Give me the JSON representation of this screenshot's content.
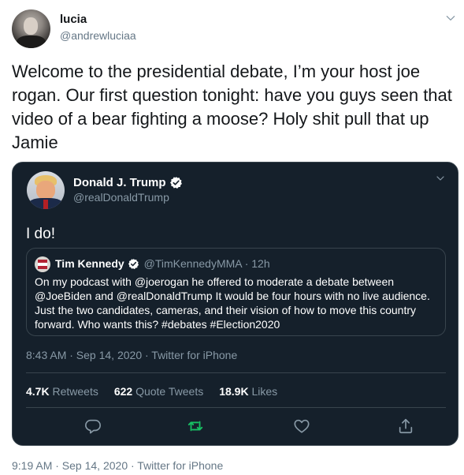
{
  "tweet": {
    "author_name": "lucia",
    "author_handle": "@andrewluciaa",
    "text": "Welcome to the presidential debate, I’m your host joe rogan. Our first question tonight: have you guys seen that video of a bear fighting a moose? Holy shit pull that up Jamie",
    "timestamp": "9:19 AM · Sep 14, 2020 · Twitter for iPhone"
  },
  "embedded": {
    "author_name": "Donald J. Trump",
    "author_handle": "@realDonaldTrump",
    "text": "I do!",
    "quoted": {
      "author_name": "Tim Kennedy",
      "meta": "@TimKennedyMMA · 12h",
      "text": "On my podcast with @joerogan he offered to moderate a debate between @JoeBiden and @realDonaldTrump It would be four hours with no live audience. Just the two candidates, cameras, and their vision of how to move this country forward. Who wants this? #debates #Election2020"
    },
    "timestamp": "8:43 AM · Sep 14, 2020 · Twitter for iPhone",
    "stats": {
      "retweets_count": "4.7K",
      "retweets_label": "Retweets",
      "quotes_count": "622",
      "quotes_label": "Quote Tweets",
      "likes_count": "18.9K",
      "likes_label": "Likes"
    }
  },
  "colors": {
    "embed_bg": "#15202b",
    "retweet_accent": "#17bf63",
    "muted": "#8899a6",
    "verified": "#ffffff"
  },
  "icons": [
    "chevron-down-icon",
    "verified-icon",
    "reply-icon",
    "retweet-icon",
    "like-icon",
    "share-icon"
  ]
}
